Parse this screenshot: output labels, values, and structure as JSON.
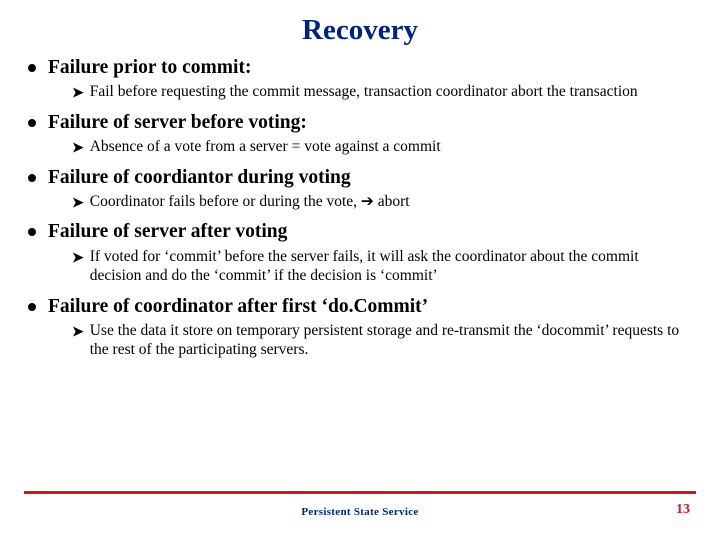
{
  "title": "Recovery",
  "bullets": [
    {
      "heading": "Failure prior to commit:",
      "subs": [
        "Fail before requesting the commit message, transaction coordinator abort the transaction"
      ]
    },
    {
      "heading": "Failure of server before voting:",
      "subs": [
        "Absence of a vote from a server = vote against a commit"
      ]
    },
    {
      "heading": "Failure of coordiantor during voting",
      "subs": [
        "Coordinator fails before or during the vote, ➔ abort"
      ]
    },
    {
      "heading": "Failure of server after voting",
      "subs": [
        "If voted for ‘commit’ before the server fails, it will ask the coordinator about the commit decision and do the ‘commit’ if the decision is ‘commit’"
      ]
    },
    {
      "heading": "Failure of coordinator after first ‘do.Commit’",
      "subs": [
        "Use the data it store on temporary persistent storage and re-transmit the ‘docommit’ requests to the rest of the participating servers."
      ]
    }
  ],
  "footer": "Persistent State  Service",
  "page": "13",
  "sub_bullet_glyph": "➤"
}
